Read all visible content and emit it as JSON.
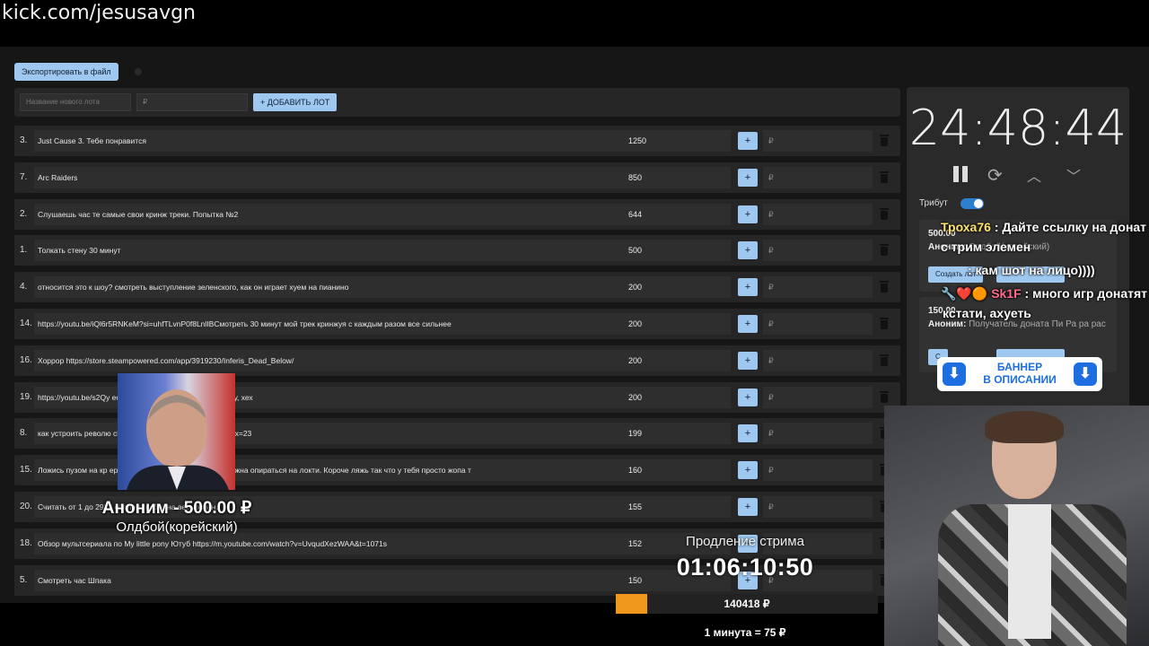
{
  "url": "kick.com/jesusavgn",
  "toolbar": {
    "export_label": "Экспортировать в файл"
  },
  "add_lot": {
    "name_placeholder": "Название нового лота",
    "sum_placeholder": "₽",
    "add_label": "+ ДОБАВИТЬ ЛОТ"
  },
  "lots": [
    {
      "num": "3.",
      "title": "Just Cause 3. Тебе понравится",
      "amount": "1250",
      "plus": "+",
      "rub": "₽"
    },
    {
      "num": "7.",
      "title": "Arc Raiders",
      "amount": "850",
      "plus": "+",
      "rub": "₽"
    },
    {
      "num": "2.",
      "title": "Слушаешь час те самые свои кринж треки. Попытка №2",
      "amount": "644",
      "plus": "+",
      "rub": "₽"
    },
    {
      "num": "1.",
      "title": "Толкать стену 30 минут",
      "amount": "500",
      "plus": "+",
      "rub": "₽"
    },
    {
      "num": "4.",
      "title": "относится это к шоу? смотреть выступление зеленского, как он играет хуем на пианино",
      "amount": "200",
      "plus": "+",
      "rub": "₽"
    },
    {
      "num": "14.",
      "title": "https://youtu.be/iQl6r5RNKeM?si=uhfTLvnP0f8LnlIBCмотреть 30 минут мой трек кринжуя с каждым разом все сильнее",
      "amount": "200",
      "plus": "+",
      "rub": "₽"
    },
    {
      "num": "16.",
      "title": "Хоррор https://store.steampowered.com/app/3919230/Inferis_Dead_Below/",
      "amount": "200",
      "plus": "+",
      "rub": "₽"
    },
    {
      "num": "19.",
      "title": "https://youtu.be/s2Qy                                  если зайдет, то можно еще парочку, хех",
      "amount": "200",
      "plus": "+",
      "rub": "₽"
    },
    {
      "num": "8.",
      "title": "как устроить револю                                  ch?v=IPSCP0_5KRE&list=WL&index=23",
      "amount": "199",
      "plus": "+",
      "rub": "₽"
    },
    {
      "num": "15.",
      "title": "Ложись пузом на кр                                  ери жопу. Передняя твоя часть должна опираться на локти. Короче ляжь так что у тебя просто жопа т",
      "amount": "160",
      "plus": "+",
      "rub": "₽"
    },
    {
      "num": "20.",
      "title": "Считать от 1 до 2939                                  ебалом. вебку на весь экран.",
      "amount": "155",
      "plus": "+",
      "rub": "₽"
    },
    {
      "num": "18.",
      "title": "Обзор мультсериала по My little pony Ютуб https://m.youtube.com/watch?v=UvqudXezWAA&t=1071s",
      "amount": "152",
      "plus": "+",
      "rub": "₽"
    },
    {
      "num": "5.",
      "title": "Смотреть час Шпака",
      "amount": "150",
      "plus": "+",
      "rub": "₽"
    }
  ],
  "side": {
    "timer": "24:48:44",
    "tribute_label": "Трибут",
    "cards": [
      {
        "amount": "500.00",
        "who_label": "Аноним:",
        "who_text": "Олдбой(корейский)",
        "btn_label": "Создать лот"
      },
      {
        "amount": "150.00",
        "who_label": "Аноним:",
        "who_text": "Получатель доната Пи Ра ра рас",
        "btn_label": "С"
      }
    ]
  },
  "overlay": {
    "donor_name": "Аноним - 500.00 ₽",
    "donor_msg": "Олдбой(корейский)",
    "extension_label": "Продление стрима",
    "extension_timer": "01:06:10:50",
    "progress_text": "140418 ₽",
    "progress_fraction": 0.12,
    "rate": "1 минута = 75 ₽",
    "banner_text_1": "БАННЕР",
    "banner_text_2": "В ОПИСАНИИ",
    "chat": [
      {
        "user": "Троха76",
        "text": ": Дайте ссылку на донат"
      },
      {
        "user": "",
        "text": "с трим элемен"
      },
      {
        "user": "",
        "text": ": кам шот на лицо))))"
      },
      {
        "user": "Sk1F",
        "text": ": много игр донатят"
      },
      {
        "user": "",
        "text": "кстати, ахуеть"
      }
    ]
  },
  "colors": {
    "accent": "#9fc8f1",
    "progress": "#f0971e",
    "toggle": "#2f7fd1"
  }
}
